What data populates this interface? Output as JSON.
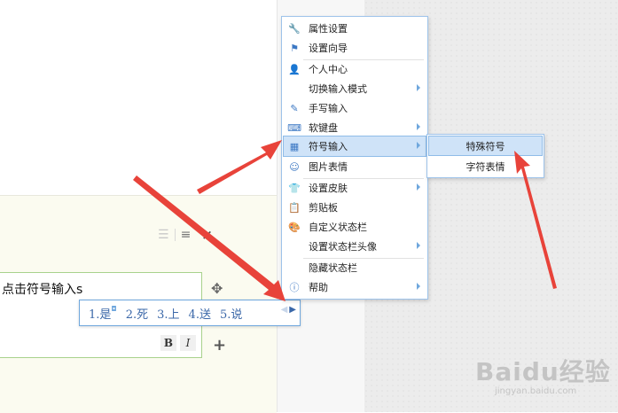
{
  "context_menu": {
    "items": [
      {
        "label": "属性设置",
        "icon": "wrench-icon",
        "has_submenu": false
      },
      {
        "label": "设置向导",
        "icon": "flag-icon",
        "has_submenu": false
      },
      {
        "label": "个人中心",
        "icon": "user-icon",
        "has_submenu": false
      },
      {
        "label": "切换输入模式",
        "icon": "",
        "has_submenu": true
      },
      {
        "label": "手写输入",
        "icon": "pen-icon",
        "has_submenu": false
      },
      {
        "label": "软键盘",
        "icon": "keyboard-icon",
        "has_submenu": true
      },
      {
        "label": "符号输入",
        "icon": "symbol-icon",
        "has_submenu": true
      },
      {
        "label": "图片表情",
        "icon": "smiley-icon",
        "has_submenu": false
      },
      {
        "label": "设置皮肤",
        "icon": "shirt-icon",
        "has_submenu": true
      },
      {
        "label": "剪贴板",
        "icon": "clipboard-icon",
        "has_submenu": false
      },
      {
        "label": "自定义状态栏",
        "icon": "palette-icon",
        "has_submenu": false
      },
      {
        "label": "设置状态栏头像",
        "icon": "",
        "has_submenu": true
      },
      {
        "label": "隐藏状态栏",
        "icon": "",
        "has_submenu": false
      },
      {
        "label": "帮助",
        "icon": "help-icon",
        "has_submenu": true
      }
    ]
  },
  "submenu": {
    "items": [
      {
        "label": "特殊符号"
      },
      {
        "label": "字符表情"
      }
    ]
  },
  "editor": {
    "text": "点击符号输入s",
    "bold_label": "B",
    "italic_label": "I",
    "close_label": "×",
    "plus_label": "+"
  },
  "candidates": {
    "items": [
      "1.是",
      "2.死",
      "3.上",
      "4.送",
      "5.说"
    ]
  },
  "watermark": {
    "brand": "Baidu经验",
    "site": "jingyan.baidu.com"
  },
  "colors": {
    "accent": "#6fa7dd",
    "highlight": "#cfe3f8",
    "annotation_arrow": "#e8433a"
  }
}
